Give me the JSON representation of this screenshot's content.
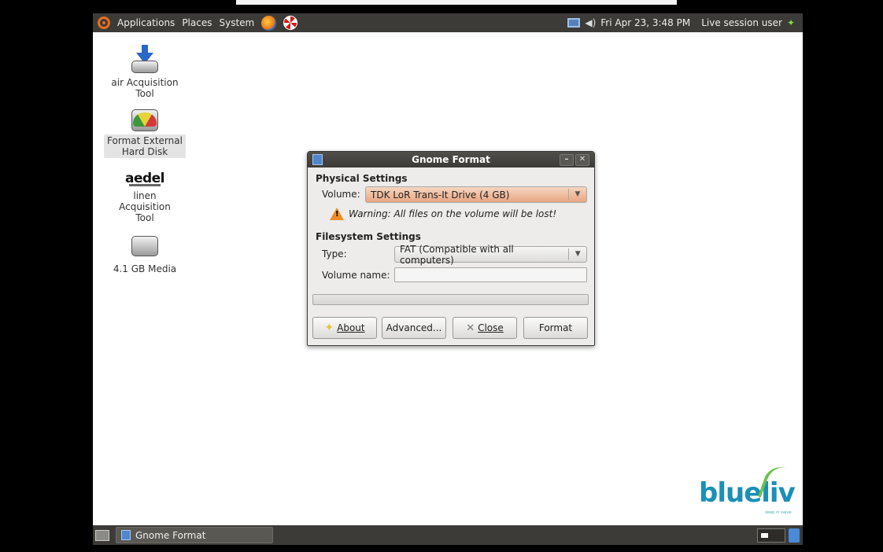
{
  "top_panel": {
    "menus": [
      "Applications",
      "Places",
      "System"
    ],
    "clock": "Fri Apr 23,  3:48 PM",
    "user": "Live session user"
  },
  "desktop_icons": [
    {
      "label": "air Acquisition Tool",
      "icon": "download-arrow-icon"
    },
    {
      "label": "Format External Hard Disk",
      "icon": "disk-gauge-icon"
    },
    {
      "label": "linen Acquisition Tool",
      "icon": "aedel-logo",
      "logo_text": "aedel"
    },
    {
      "label": "4.1 GB Media",
      "icon": "drive-icon"
    }
  ],
  "dialog": {
    "title": "Gnome Format",
    "physical_heading": "Physical Settings",
    "volume_label": "Volume:",
    "volume_value": "TDK LoR Trans-It Drive (4 GB)",
    "warning": "Warning: All files on the volume will be lost!",
    "filesystem_heading": "Filesystem Settings",
    "type_label": "Type:",
    "type_value": "FAT (Compatible with all computers)",
    "volume_name_label": "Volume name:",
    "volume_name_value": "",
    "buttons": {
      "about": "About",
      "advanced": "Advanced...",
      "close": "Close",
      "format": "Format"
    }
  },
  "bottom_panel": {
    "task_label": "Gnome Format"
  },
  "watermark": {
    "text_blue": "blue",
    "text_liv": "liv",
    "tagline": "keep in value"
  },
  "colors": {
    "panel": "#3c3b37",
    "accent_orange": "#e86d1f",
    "volume_combo": "#e8a682",
    "logo_blue": "#1b8fb7",
    "logo_green": "#6cc24a"
  }
}
